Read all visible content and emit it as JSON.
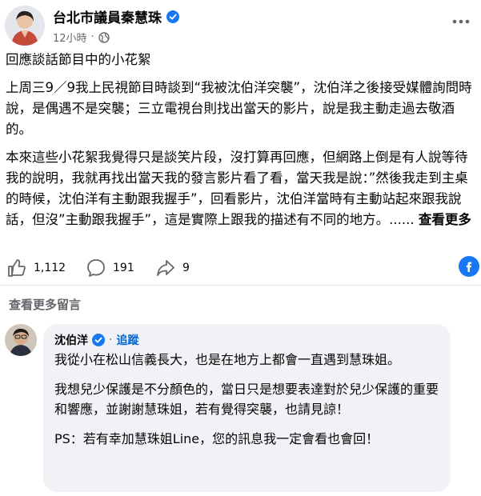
{
  "post": {
    "page_name": "台北市議員秦慧珠",
    "time": "12小時",
    "separator": "·",
    "title_line": "回應談話節目中的小花絮",
    "paragraph1": "上周三9／9我上民視節目時談到“我被沈伯洋突襲”，沈伯洋之後接受媒體詢問時說，是偶遇不是突襲；三立電視台則找出當天的影片，說是我主動走過去敬酒的。",
    "paragraph2": "本來這些小花絮我覺得只是談笑片段，沒打算再回應，但網路上倒是有人說等待我的說明，我就再找出當天我的發言影片看了看，當天我是說：”然後我走到主桌的時候，沈伯洋有主動跟我握手”，回看影片，沈伯洋當時有主動站起來跟我說話，但沒”主動跟我握手”，這是實際上跟我的描述有不同的地方。......",
    "see_more": "查看更多"
  },
  "actions": {
    "likes": "1,112",
    "comments": "191",
    "shares": "9"
  },
  "more_comments_label": "查看更多留言",
  "comment": {
    "author": "沈伯洋",
    "separator": "·",
    "follow_label": "追蹤",
    "p1": "我從小在松山信義長大，也是在地方上都會一直遇到慧珠姐。",
    "p2": "我想兒少保護是不分顏色的，當日只是想要表達對於兒少保護的重要和響應，並謝謝慧珠姐，若有覺得突襲，也請見諒！",
    "p3": "PS：若有幸加慧珠姐Line，您的訊息我一定會看也會回！"
  },
  "icons": {
    "verified": "verified-badge-icon",
    "globe": "globe-icon",
    "more": "more-dots-icon",
    "like": "thumbs-up-icon",
    "comment": "comment-bubble-icon",
    "share": "share-arrow-icon",
    "messenger": "facebook-logo-icon"
  },
  "colors": {
    "accent": "#1877f2",
    "follow": "#0064d1",
    "secondary_text": "#65676b",
    "bubble_bg": "#f0f2f5"
  }
}
